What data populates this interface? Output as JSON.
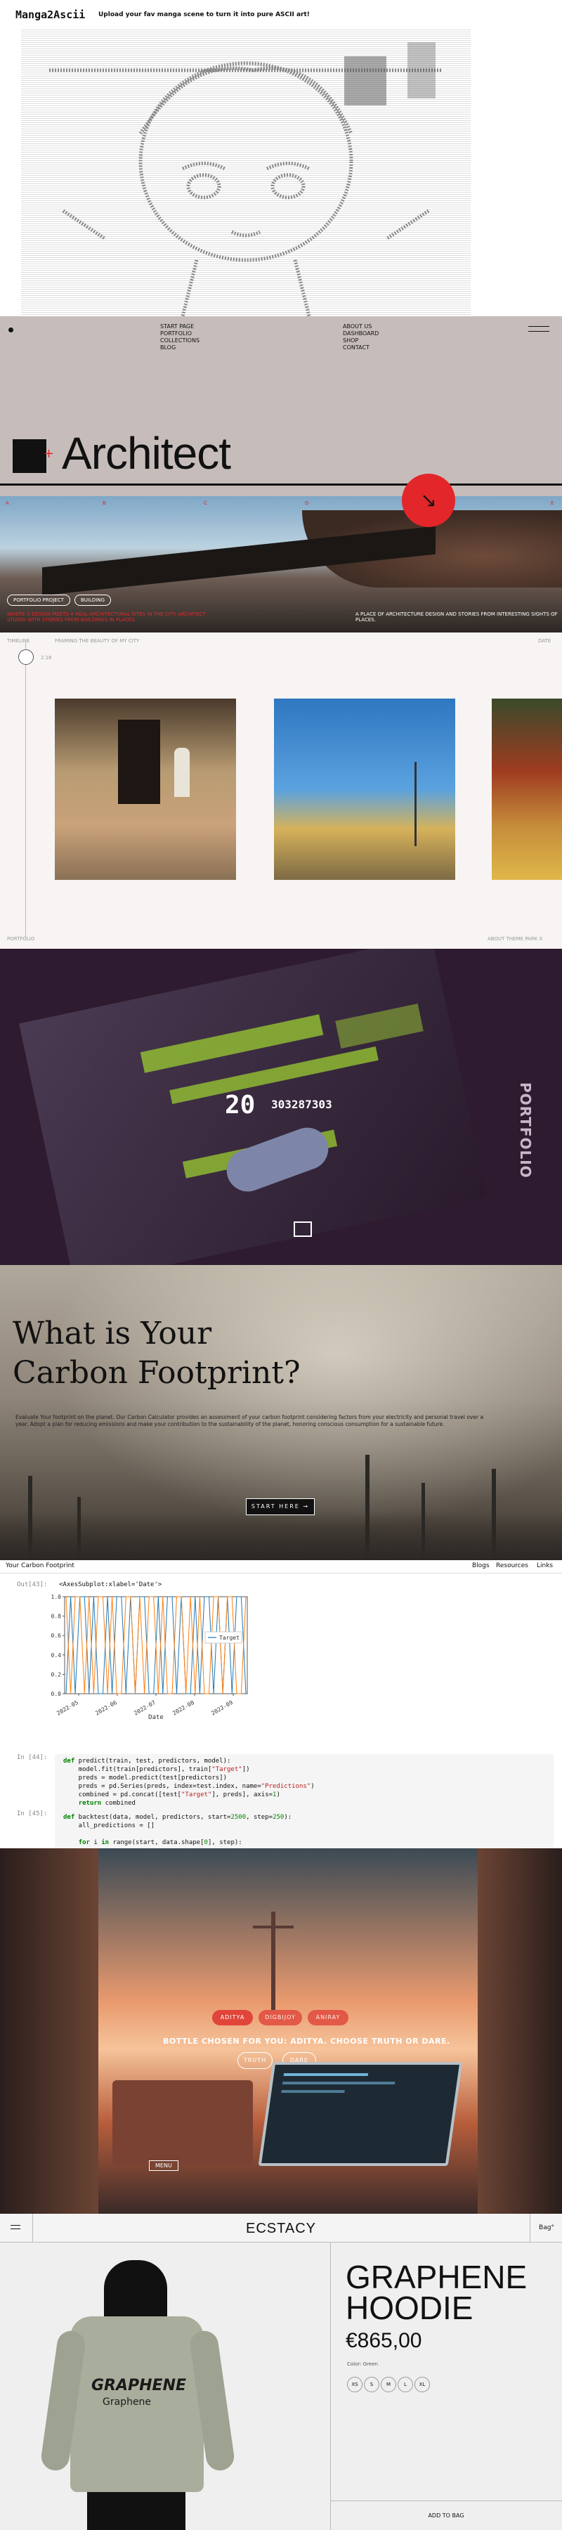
{
  "manga": {
    "logo": "Manga2Ascii",
    "tagline": "Upload your fav manga scene to turn it into pure ASCII art!"
  },
  "architect": {
    "nav_col1": [
      "START PAGE",
      "PORTFOLIO",
      "COLLECTIONS",
      "BLOG"
    ],
    "nav_col2": [
      "ABOUT US",
      "DASHBOARD",
      "SHOP",
      "CONTACT"
    ],
    "title": "Architect",
    "markers": [
      "A",
      "B",
      "C",
      "D",
      "E"
    ],
    "pills": [
      "PORTFOLIO PROJECT",
      "BUILDING"
    ],
    "red_caption": "WHERE A DESIGN MEETS A REAL ARCHITECTURAL SITES IN THE CITY. ARCHITECT STUDIO WITH STORIES FROM BUILDINGS IN PLACES.",
    "white_caption": "A PLACE OF ARCHITECTURE DESIGN AND STORIES FROM INTERESTING SIGHTS OF PLACES."
  },
  "timeline": {
    "left_top": "TIMELINE",
    "mid_top": "FRAMING THE BEAUTY OF MY CITY",
    "right_top": "DATE",
    "marker": "2.16",
    "left_bottom": "PORTFOLIO",
    "right_bottom": "ABOUT THEME PARK X"
  },
  "pixel": {
    "big_number": "20",
    "small_number": "303287303",
    "vertical_text": "PORTFOLIO"
  },
  "carbon": {
    "title_line1": "What is Your",
    "title_line2": "Carbon Footprint?",
    "body": "Evaluate Your footprint on the planet. Our Carbon Calculator provides an assessment of your carbon footprint considering factors from your electricity and personal travel over a year. Adopt a plan for reducing emissions and make your contribution to the sustainability of the planet, honoring conscious consumption for a sustainable future.",
    "button": "START HERE →"
  },
  "notebook": {
    "header_title": "Your Carbon Footprint",
    "header_links": [
      "Blogs",
      "Resources",
      "Links"
    ],
    "cell1_prompt": "Out[43]:",
    "cell1_out": "<AxesSubplot:xlabel='Date'>",
    "cell2_prompt": "In [44]:",
    "cell3_prompt": "In [45]:",
    "chart_legend": "Target",
    "chart_xlabel": "Date"
  },
  "chart_data": {
    "type": "line",
    "xlabel": "Date",
    "ylim": [
      0.0,
      1.0
    ],
    "y_ticks": [
      "0.0",
      "0.2",
      "0.4",
      "0.6",
      "0.8",
      "1.0"
    ],
    "x_ticks": [
      "2022-05",
      "2022-06",
      "2022-07",
      "2022-08",
      "2022-09"
    ],
    "series": [
      {
        "name": "Target",
        "color": "#1f77b4",
        "values": [
          0,
          1,
          0,
          1,
          1,
          0,
          1,
          0,
          0,
          1,
          0,
          1,
          1,
          0,
          1,
          0,
          1,
          1,
          0,
          0,
          1,
          0,
          1,
          1,
          0,
          1,
          0,
          0,
          1,
          0,
          1,
          1,
          0,
          1,
          0,
          1,
          0,
          1,
          1,
          0
        ]
      },
      {
        "name": "",
        "color": "#ff7f0e",
        "values": [
          1,
          0,
          1,
          1,
          0,
          1,
          0,
          1,
          1,
          0,
          1,
          0,
          0,
          1,
          1,
          0,
          1,
          0,
          1,
          1,
          0,
          1,
          0,
          0,
          1,
          1,
          0,
          1,
          0,
          1,
          0,
          0,
          1,
          1,
          0,
          1,
          1,
          0,
          0,
          1
        ]
      }
    ]
  },
  "sunset": {
    "buttons": [
      "ADITYA",
      "DIGBIJOY",
      "ANIRAY"
    ],
    "prompt": "BOTTLE CHOSEN FOR YOU: ADITYA. CHOOSE TRUTH OR DARE.",
    "choices": [
      "TRUTH",
      "DARE"
    ],
    "corner_label": "MENU"
  },
  "ecstacy": {
    "brand": "ECSTACY",
    "bag": "Bag°",
    "product_line1": "GRAPHENE",
    "product_line2": "HOODIE",
    "price": "€865,00",
    "color_label": "Color: Green",
    "sizes": [
      "XS",
      "S",
      "M",
      "L",
      "XL"
    ],
    "cta": "ADD TO BAG",
    "shirt_word": "GRAPHENE",
    "shirt_sub": "Graphene"
  }
}
